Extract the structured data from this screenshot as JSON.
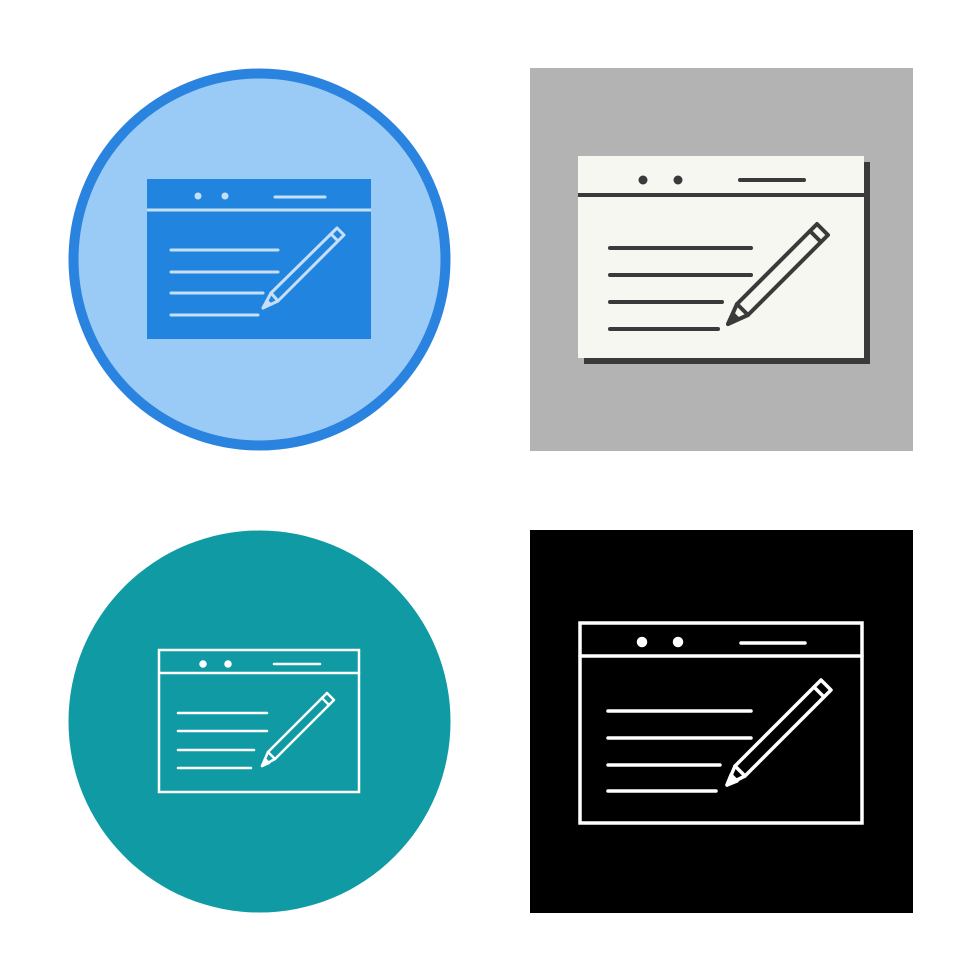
{
  "icon_set": {
    "subject": "browser-window-with-pencil-icon",
    "variants": [
      {
        "style": "flat-circle",
        "icon": "edit-document-icon",
        "colors": {
          "background": "#9acbf6",
          "ring": "#2b83e0",
          "window": "#2185e0",
          "lines": "#c6dff6"
        }
      },
      {
        "style": "glyph-square",
        "icon": "edit-document-icon",
        "colors": {
          "background": "#b3b3b3",
          "window": "#f7f7f1",
          "shadow": "#3a3a3a",
          "lines": "#3a3a3a"
        }
      },
      {
        "style": "outline-circle",
        "icon": "edit-document-icon",
        "colors": {
          "background": "#0f9aa4",
          "lines": "#ffffff"
        }
      },
      {
        "style": "outline-square",
        "icon": "edit-document-icon",
        "colors": {
          "background": "#000000",
          "lines": "#ffffff"
        }
      }
    ]
  }
}
